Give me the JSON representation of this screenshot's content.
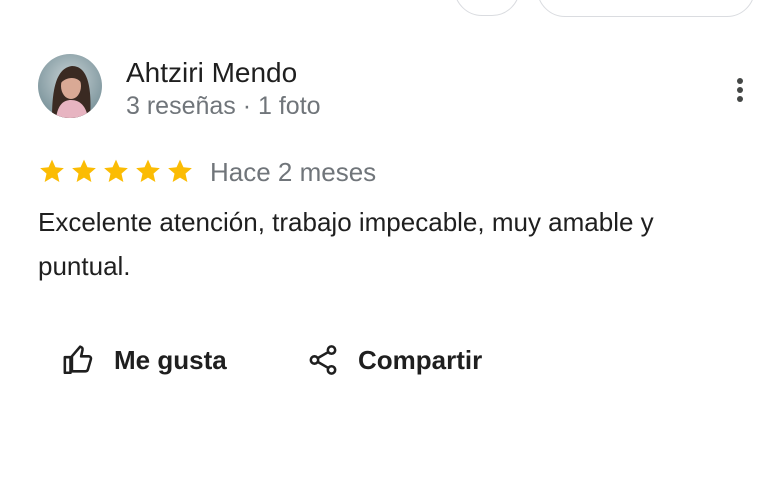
{
  "reviewer": {
    "name": "Ahtziri Mendo",
    "meta": "3 reseñas · 1 foto",
    "avatar_icon": "avatar-photo"
  },
  "review": {
    "rating": 5,
    "rating_max": 5,
    "date": "Hace 2 meses",
    "text": "Excelente atención, trabajo impecable, muy amable y puntual."
  },
  "actions": {
    "like_label": "Me gusta",
    "share_label": "Compartir",
    "more_icon": "more-vert-icon"
  },
  "colors": {
    "star": "#fbbc04",
    "text_primary": "#1f1f1f",
    "text_secondary": "#70757a",
    "border": "#dadce0"
  }
}
